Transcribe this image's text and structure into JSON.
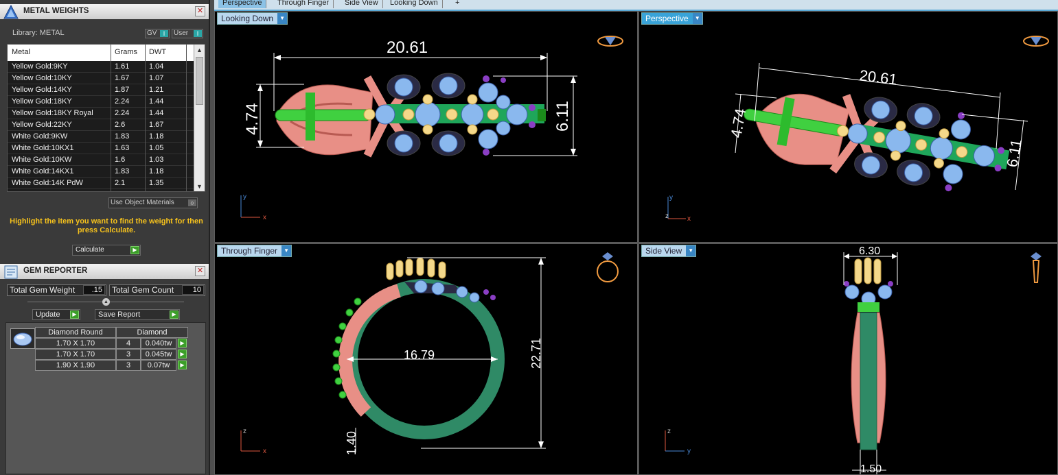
{
  "metal_weights": {
    "title": "METAL WEIGHTS",
    "library_label": "Library: METAL",
    "gv_label": "GV",
    "user_label": "User",
    "columns": [
      "Metal",
      "Grams",
      "DWT"
    ],
    "rows": [
      {
        "metal": "Yellow Gold:9KY",
        "grams": "1.61",
        "dwt": "1.04"
      },
      {
        "metal": "Yellow Gold:10KY",
        "grams": "1.67",
        "dwt": "1.07"
      },
      {
        "metal": "Yellow Gold:14KY",
        "grams": "1.87",
        "dwt": "1.21"
      },
      {
        "metal": "Yellow Gold:18KY",
        "grams": "2.24",
        "dwt": "1.44"
      },
      {
        "metal": "Yellow Gold:18KY Royal",
        "grams": "2.24",
        "dwt": "1.44"
      },
      {
        "metal": "Yellow Gold:22KY",
        "grams": "2.6",
        "dwt": "1.67"
      },
      {
        "metal": "White Gold:9KW",
        "grams": "1.83",
        "dwt": "1.18"
      },
      {
        "metal": "White Gold:10KX1",
        "grams": "1.63",
        "dwt": "1.05"
      },
      {
        "metal": "White Gold:10KW",
        "grams": "1.6",
        "dwt": "1.03"
      },
      {
        "metal": "White Gold:14KX1",
        "grams": "1.83",
        "dwt": "1.18"
      },
      {
        "metal": "White Gold:14K PdW",
        "grams": "2.1",
        "dwt": "1.35"
      }
    ],
    "use_object_materials": "Use Object Materials",
    "hint": "Highlight the item you want to find the weight for then press Calculate.",
    "calculate_label": "Calculate"
  },
  "gem_reporter": {
    "title": "GEM REPORTER",
    "total_weight_label": "Total Gem Weight",
    "total_weight_value": ".15",
    "total_count_label": "Total Gem Count",
    "total_count_value": "10",
    "update_label": "Update",
    "save_report_label": "Save Report",
    "table_headers": [
      "Diamond Round",
      "Diamond"
    ],
    "rows": [
      {
        "size": "1.70 X 1.70",
        "count": "4",
        "weight": "0.040tw"
      },
      {
        "size": "1.70 X 1.70",
        "count": "3",
        "weight": "0.045tw"
      },
      {
        "size": "1.90 X 1.90",
        "count": "3",
        "weight": "0.07tw"
      }
    ]
  },
  "tabs": [
    "Perspective",
    "Through Finger",
    "Side View",
    "Looking Down"
  ],
  "viewports": {
    "top_left": {
      "label": "Looking Down",
      "dim_length": "20.61",
      "dim_height": "4.74",
      "dim_width": "6.11",
      "axis_v": "y",
      "axis_h": "x"
    },
    "top_right": {
      "label": "Perspective",
      "dim_length": "20.61",
      "dim_height": "4.74",
      "dim_width": "6.11",
      "axis_v": "y",
      "axis_z": "z",
      "axis_h": "x"
    },
    "bottom_left": {
      "label": "Through Finger",
      "dim_inner": "16.79",
      "dim_height": "22.71",
      "dim_shank": "1.40",
      "axis_v": "z",
      "axis_h": "x"
    },
    "bottom_right": {
      "label": "Side View",
      "dim_top": "6.30",
      "dim_bottom": "1.50",
      "axis_v": "z",
      "axis_h": "y"
    }
  },
  "colors": {
    "accent": "#39a3d8",
    "hint": "#f6c21c",
    "metal_pink": "#e88f86",
    "gem_blue": "#8ab8ee",
    "green": "#2fbf2f"
  }
}
